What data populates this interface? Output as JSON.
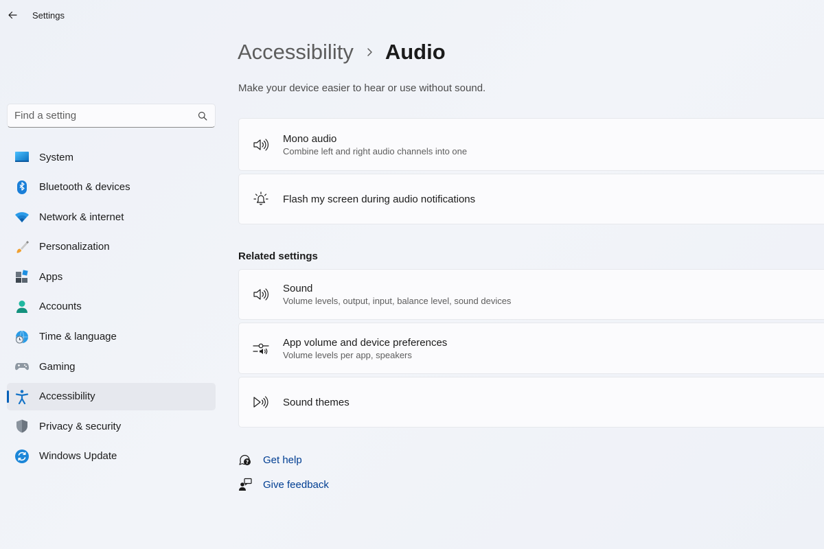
{
  "window": {
    "title": "Settings"
  },
  "search": {
    "placeholder": "Find a setting"
  },
  "sidebar": {
    "items": [
      {
        "label": "System",
        "icon": "system-icon"
      },
      {
        "label": "Bluetooth & devices",
        "icon": "bluetooth-icon"
      },
      {
        "label": "Network & internet",
        "icon": "wifi-icon"
      },
      {
        "label": "Personalization",
        "icon": "brush-icon"
      },
      {
        "label": "Apps",
        "icon": "apps-icon"
      },
      {
        "label": "Accounts",
        "icon": "accounts-icon"
      },
      {
        "label": "Time & language",
        "icon": "time-language-icon"
      },
      {
        "label": "Gaming",
        "icon": "gamepad-icon"
      },
      {
        "label": "Accessibility",
        "icon": "accessibility-icon",
        "active": true
      },
      {
        "label": "Privacy & security",
        "icon": "shield-icon"
      },
      {
        "label": "Windows Update",
        "icon": "windows-update-icon"
      }
    ]
  },
  "header": {
    "parent": "Accessibility",
    "current": "Audio",
    "description": "Make your device easier to hear or use without sound."
  },
  "settings": [
    {
      "title": "Mono audio",
      "subtitle": "Combine left and right audio channels into one",
      "icon": "speaker-icon"
    },
    {
      "title": "Flash my screen during audio notifications",
      "icon": "flash-notification-icon"
    }
  ],
  "related": {
    "heading": "Related settings",
    "items": [
      {
        "title": "Sound",
        "subtitle": "Volume levels, output, input, balance level, sound devices",
        "icon": "speaker-icon"
      },
      {
        "title": "App volume and device preferences",
        "subtitle": "Volume levels per app, speakers",
        "icon": "volume-mixer-icon"
      },
      {
        "title": "Sound themes",
        "icon": "sound-themes-icon"
      }
    ]
  },
  "help": {
    "get_help": "Get help",
    "give_feedback": "Give feedback"
  },
  "colors": {
    "accent": "#005fb8",
    "link": "#003e92"
  }
}
